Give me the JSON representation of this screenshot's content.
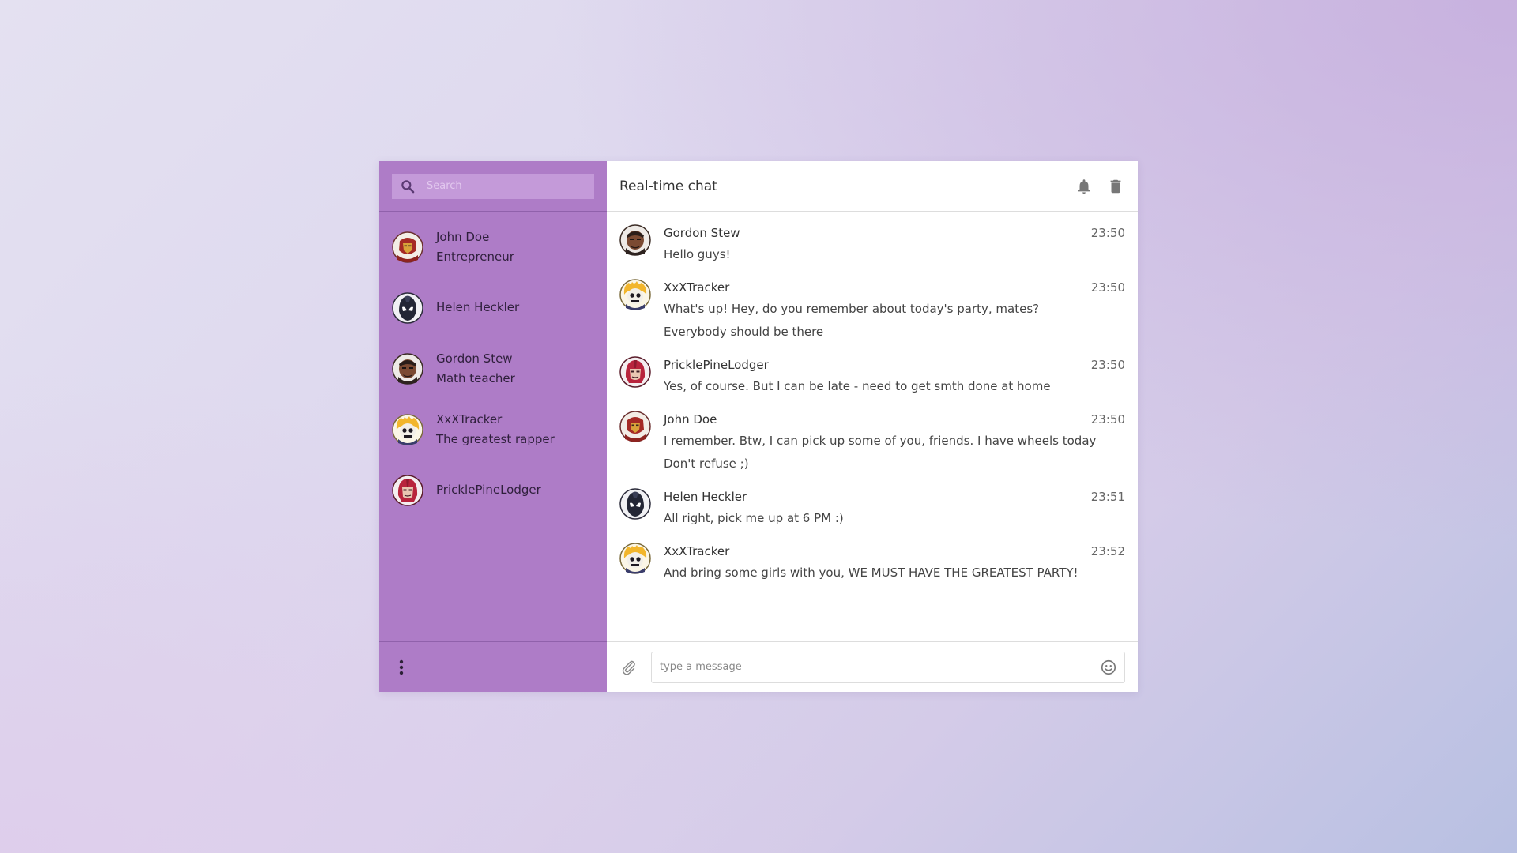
{
  "search": {
    "placeholder": "Search",
    "icon": "search-icon"
  },
  "contacts": [
    {
      "name": "John Doe",
      "subtitle": "Entrepreneur",
      "avatar": "iron-hero-avatar"
    },
    {
      "name": "Helen Heckler",
      "subtitle": "",
      "avatar": "dark-mask-avatar"
    },
    {
      "name": "Gordon Stew",
      "subtitle": "Math teacher",
      "avatar": "brute-avatar"
    },
    {
      "name": "XxXTracker",
      "subtitle": "The greatest rapper",
      "avatar": "flame-skull-avatar"
    },
    {
      "name": "PricklePineLodger",
      "subtitle": "",
      "avatar": "red-helmet-avatar"
    }
  ],
  "sidebar_footer": {
    "icon": "more-vertical-icon"
  },
  "header": {
    "title": "Real-time chat",
    "icons": [
      "bell-icon",
      "trash-icon"
    ]
  },
  "messages": [
    {
      "author": "Gordon Stew",
      "time": "23:50",
      "lines": [
        "Hello guys!"
      ],
      "avatar": "brute-avatar"
    },
    {
      "author": "XxXTracker",
      "time": "23:50",
      "lines": [
        "What's up! Hey, do you remember about today's party, mates?",
        "Everybody should be there"
      ],
      "avatar": "flame-skull-avatar"
    },
    {
      "author": "PricklePineLodger",
      "time": "23:50",
      "lines": [
        "Yes, of course. But I can be late - need to get smth done at home"
      ],
      "avatar": "red-helmet-avatar"
    },
    {
      "author": "John Doe",
      "time": "23:50",
      "lines": [
        "I remember. Btw, I can pick up some of you, friends. I have wheels today",
        "Don't refuse ;)"
      ],
      "avatar": "iron-hero-avatar"
    },
    {
      "author": "Helen Heckler",
      "time": "23:51",
      "lines": [
        "All right, pick me up at 6 PM :)"
      ],
      "avatar": "dark-mask-avatar"
    },
    {
      "author": "XxXTracker",
      "time": "23:52",
      "lines": [
        "And bring some girls with you, WE MUST HAVE THE GREATEST PARTY!"
      ],
      "avatar": "flame-skull-avatar"
    }
  ],
  "composer": {
    "placeholder": "type a message",
    "icons": [
      "paperclip-icon",
      "emoji-icon"
    ]
  },
  "colors": {
    "sidebar": "#ae7cc7",
    "search_bg": "#c49ad9",
    "main_bg": "#ffffff"
  }
}
